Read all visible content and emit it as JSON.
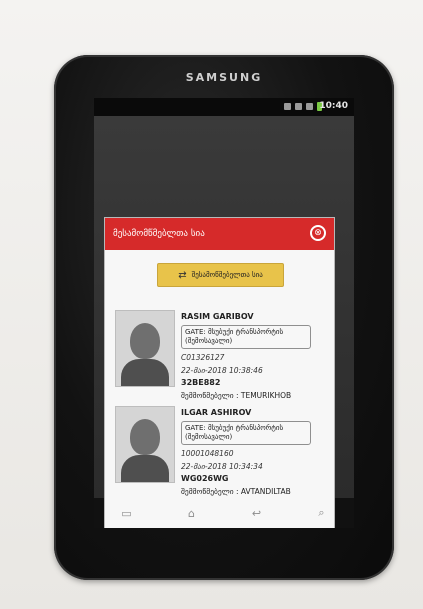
{
  "device": {
    "brand": "SAMSUNG"
  },
  "status_bar": {
    "time": "10:40"
  },
  "dialog": {
    "title": "მესამომწმებლთა სია",
    "close_glyph": "⊗",
    "primary_button": {
      "label": "შესამოწმებელთა სია"
    },
    "records": [
      {
        "name": "RASIM GARIBOV",
        "gate_label": "GATE: მსუბუქი ტრანსპორტის (შემოსავალი)",
        "id": "C01326127",
        "datetime": "22-მაი-2018 10:38:46",
        "plate": "32BE882",
        "checker": "შემმოწმებელი : TEMURIKHOB"
      },
      {
        "name": "ILGAR ASHIROV",
        "gate_label": "GATE: მსუბუქი ტრანსპორტის (შემოსავალი)",
        "id": "10001048160",
        "datetime": "22-მაი-2018 10:34:34",
        "plate": "WG026WG",
        "checker": "შემმოწმებელი : AVTANDILTAB"
      }
    ]
  },
  "nav": [
    {
      "icon": "menu-icon",
      "glyph": "▭"
    },
    {
      "icon": "home-icon",
      "glyph": "⌂"
    },
    {
      "icon": "back-icon",
      "glyph": "↩"
    },
    {
      "icon": "search-icon",
      "glyph": "⌕"
    }
  ]
}
